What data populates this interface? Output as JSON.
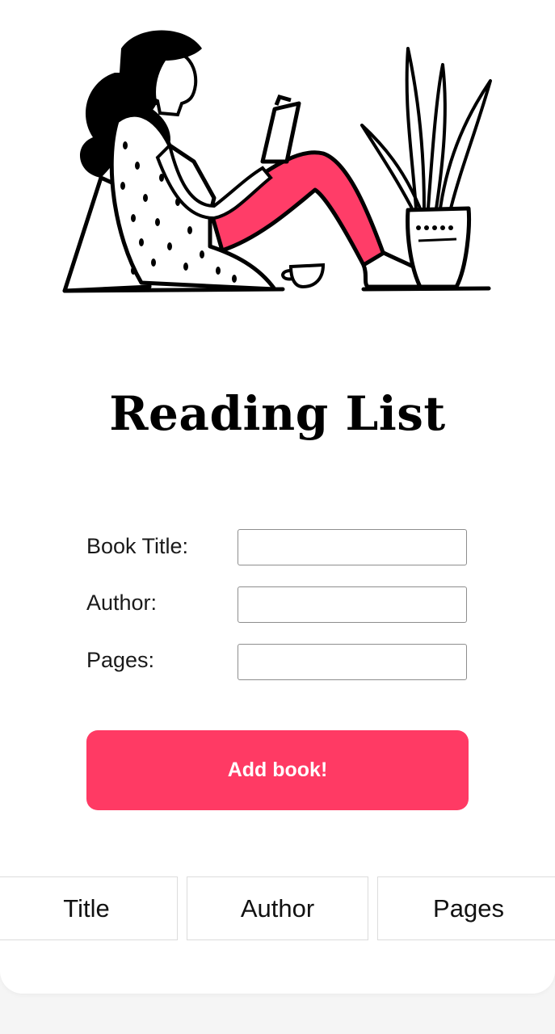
{
  "page": {
    "title": "Reading List"
  },
  "illustration": {
    "icon": "woman-reading-book-illustration",
    "accent_color": "#ff3d68"
  },
  "form": {
    "fields": [
      {
        "label": "Book Title:",
        "value": "",
        "placeholder": ""
      },
      {
        "label": "Author:",
        "value": "",
        "placeholder": ""
      },
      {
        "label": "Pages:",
        "value": "",
        "placeholder": ""
      }
    ],
    "submit_label": "Add book!",
    "submit_color": "#ff3a64"
  },
  "table": {
    "columns": [
      "Title",
      "Author",
      "Pages"
    ],
    "rows": []
  }
}
